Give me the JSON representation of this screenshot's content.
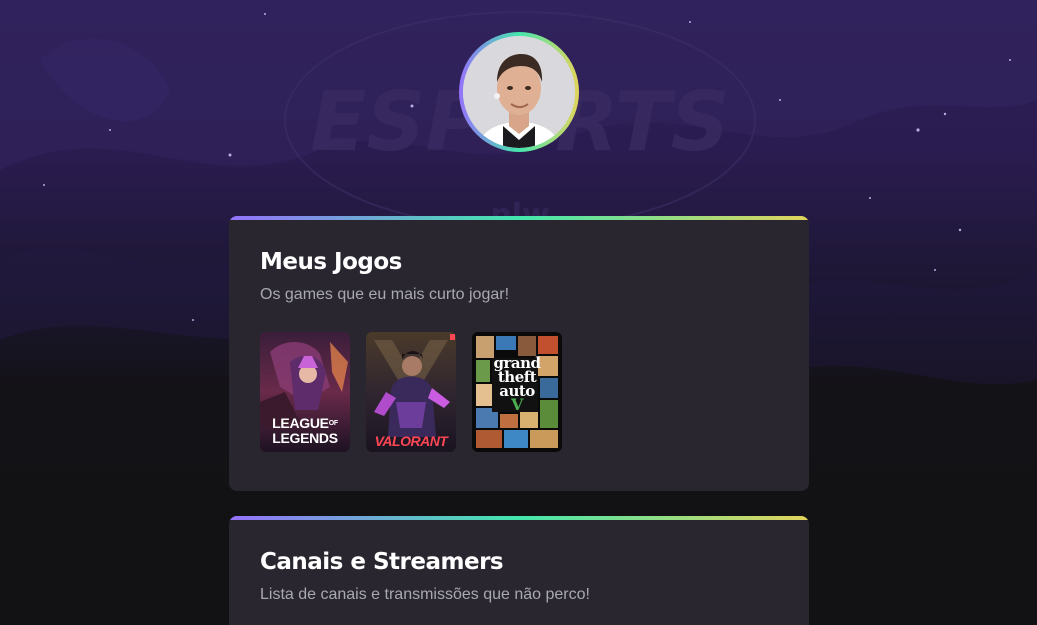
{
  "profile": {
    "avatar_alt": "Foto de perfil"
  },
  "games_section": {
    "title": "Meus Jogos",
    "subtitle": "Os games que eu mais curto jogar!",
    "games": [
      {
        "name": "League of Legends",
        "label_line1": "LEAGUE",
        "label_line2": "LEGENDS",
        "label_of": "OF"
      },
      {
        "name": "Valorant",
        "label": "VALORANT"
      },
      {
        "name": "Grand Theft Auto V",
        "label_line1": "grand",
        "label_line2": "theft",
        "label_line3": "auto",
        "label_numeral": "V"
      }
    ]
  },
  "channels_section": {
    "title": "Canais e Streamers",
    "subtitle": "Lista de canais e transmissões que não perco!"
  },
  "background": {
    "logo_text": "ESPORTS",
    "logo_subtext": "nlw"
  },
  "colors": {
    "gradient_start": "#9572fc",
    "gradient_mid": "#43e7ad",
    "gradient_end": "#e2d45c",
    "card_bg": "#29262f",
    "page_bg": "#121214",
    "text_primary": "#ffffff",
    "text_secondary": "#a8a8b3"
  }
}
